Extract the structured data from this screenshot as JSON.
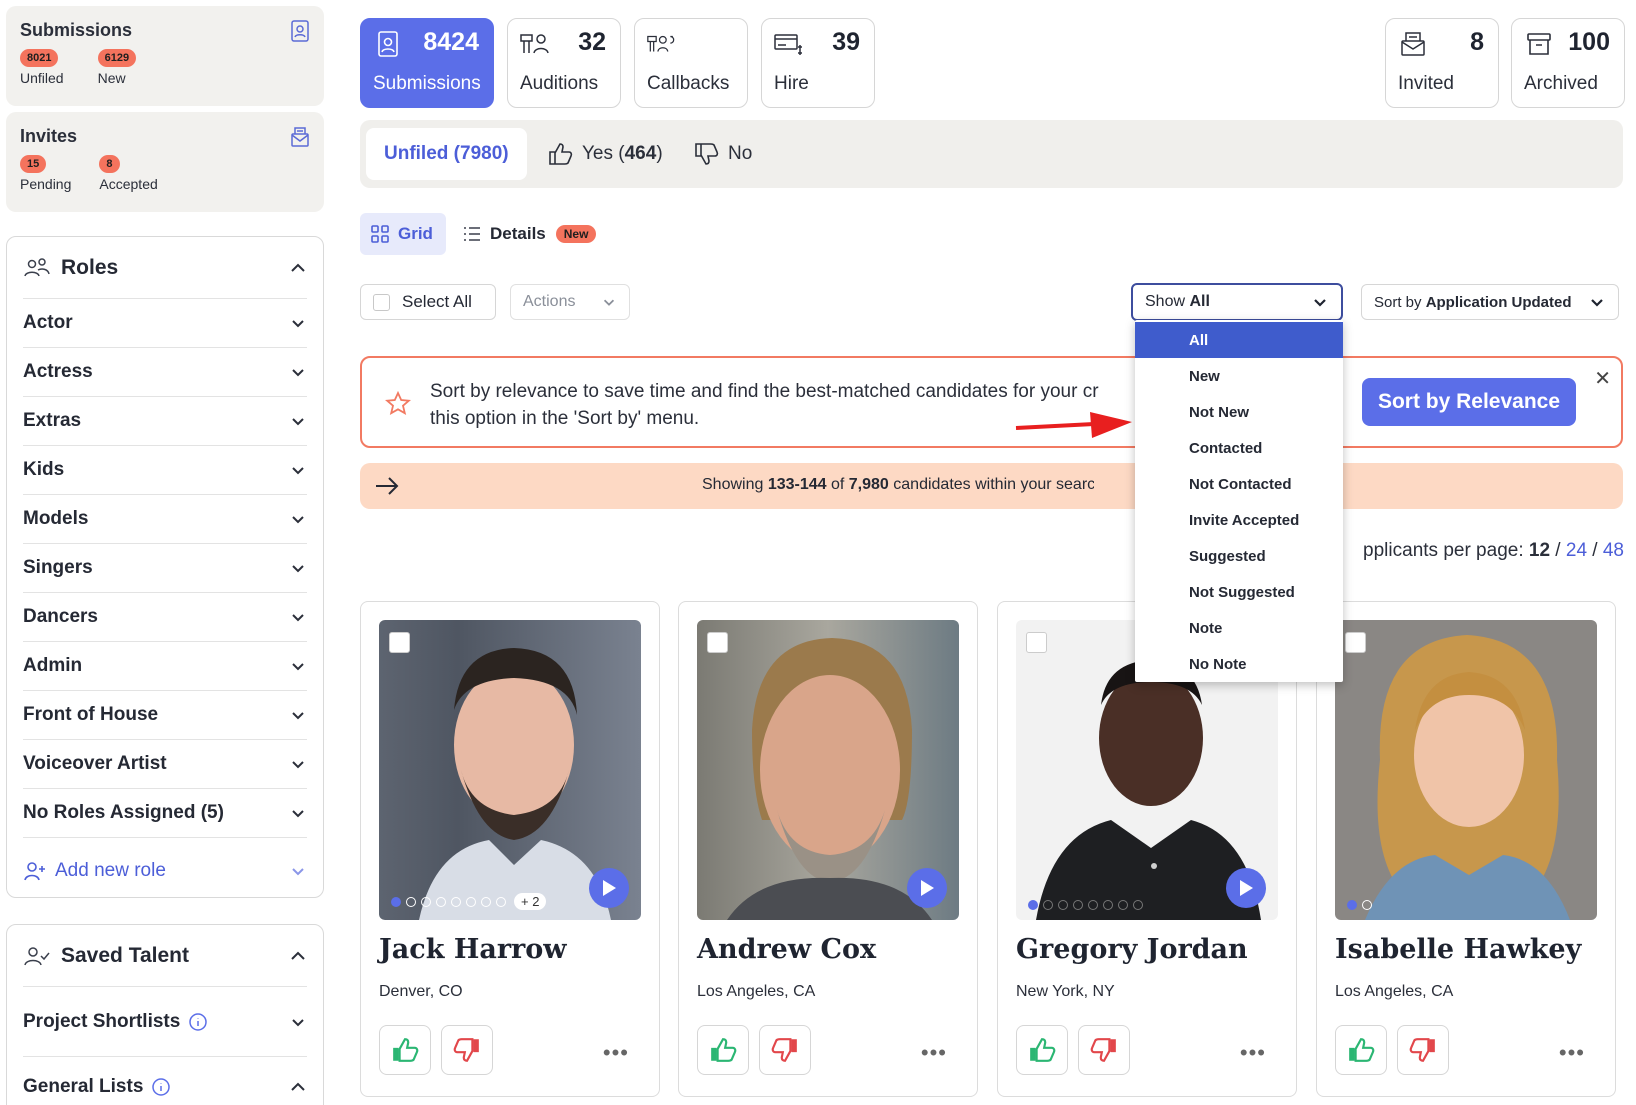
{
  "sidebar": {
    "submissions": {
      "title": "Submissions",
      "unfiled_count": "8021",
      "unfiled_label": "Unfiled",
      "new_count": "6129",
      "new_label": "New"
    },
    "invites": {
      "title": "Invites",
      "pending_count": "15",
      "pending_label": "Pending",
      "accepted_count": "8",
      "accepted_label": "Accepted"
    },
    "roles": {
      "title": "Roles",
      "items": [
        "Actor",
        "Actress",
        "Extras",
        "Kids",
        "Models",
        "Singers",
        "Dancers",
        "Admin",
        "Front of House",
        "Voiceover Artist",
        "No Roles Assigned (5)"
      ],
      "add_label": "Add new role"
    },
    "saved_talent": {
      "title": "Saved Talent",
      "project_shortlists": "Project Shortlists",
      "general_lists": "General Lists"
    }
  },
  "stats": {
    "submissions": {
      "num": "8424",
      "label": "Submissions"
    },
    "auditions": {
      "num": "32",
      "label": "Auditions"
    },
    "callbacks": {
      "label": "Callbacks"
    },
    "hire": {
      "num": "39",
      "label": "Hire"
    },
    "invited": {
      "num": "8",
      "label": "Invited"
    },
    "archived": {
      "num": "100",
      "label": "Archived"
    }
  },
  "tabs": {
    "unfiled": {
      "label": "Unfiled",
      "count": "(7980)"
    },
    "yes": {
      "label": "Yes",
      "count_open": "(",
      "count": "464",
      "count_close": ")"
    },
    "no": {
      "label": "No"
    }
  },
  "view": {
    "grid": "Grid",
    "details": "Details",
    "new_badge": "New"
  },
  "toolbar": {
    "select_all": "Select All",
    "actions": "Actions",
    "filter_prefix": "Show ",
    "filter_value": "All",
    "sort_prefix": "Sort by ",
    "sort_value": "Application Updated"
  },
  "dropdown": {
    "options": [
      "All",
      "New",
      "Not New",
      "Contacted",
      "Not Contacted",
      "Invite Accepted",
      "Suggested",
      "Not Suggested",
      "Note",
      "No Note"
    ],
    "selected": "All"
  },
  "banner": {
    "line1": "Sort by relevance to save time and find the best-matched candidates for your cr",
    "line2": "this option in the 'Sort by' menu.",
    "cta": "Sort by Relevance"
  },
  "showing": {
    "prefix": "Showing ",
    "range": "133-144",
    "of": " of ",
    "total": "7,980",
    "suffix": " candidates within your search"
  },
  "perpage": {
    "label": "pplicants per page: ",
    "opt1": "12",
    "sep": " / ",
    "opt2": "24",
    "opt3": "48"
  },
  "candidates": [
    {
      "name": "Jack Harrow",
      "location": "Denver, CO",
      "extra_photos": "+ 2"
    },
    {
      "name": "Andrew Cox",
      "location": "Los Angeles, CA"
    },
    {
      "name": "Gregory Jordan",
      "location": "New York, NY"
    },
    {
      "name": "Isabelle Hawkey",
      "location": "Los Angeles, CA"
    }
  ],
  "colors": {
    "accent": "#5b6ee8",
    "badge": "#f4735d",
    "banner_border": "#f27a62",
    "showing_bg": "#fdd9c4",
    "thumb_up": "#2bb673",
    "thumb_down": "#e2474b"
  }
}
